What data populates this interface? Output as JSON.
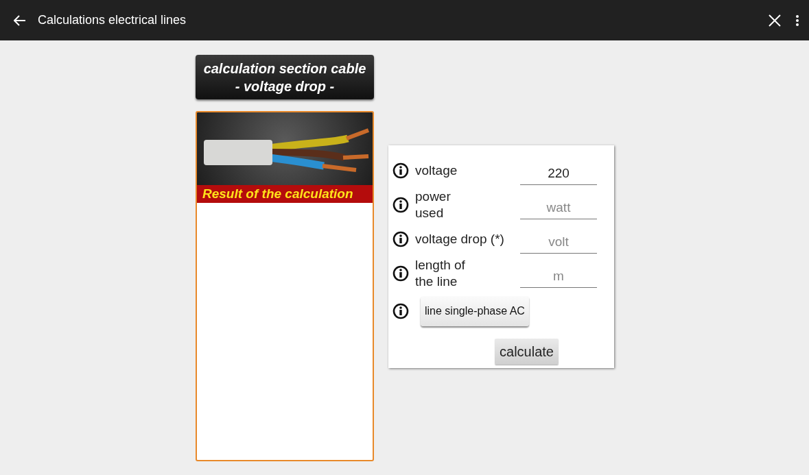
{
  "app_bar": {
    "title": "Calculations electrical lines"
  },
  "heading": {
    "lines": [
      "calculation section cable",
      "- voltage drop -"
    ]
  },
  "result": {
    "title": "Result of the calculation"
  },
  "form": {
    "rows": [
      {
        "kind": "field",
        "label": "voltage",
        "value": "220"
      },
      {
        "kind": "field",
        "label": "power\nused",
        "placeholder": "watt"
      },
      {
        "kind": "field",
        "label": "voltage drop (*)",
        "placeholder": "volt"
      },
      {
        "kind": "field",
        "label": "length of\nthe line",
        "placeholder": "m"
      },
      {
        "kind": "button",
        "label": "line single-phase AC"
      }
    ],
    "submit": "calculate"
  }
}
